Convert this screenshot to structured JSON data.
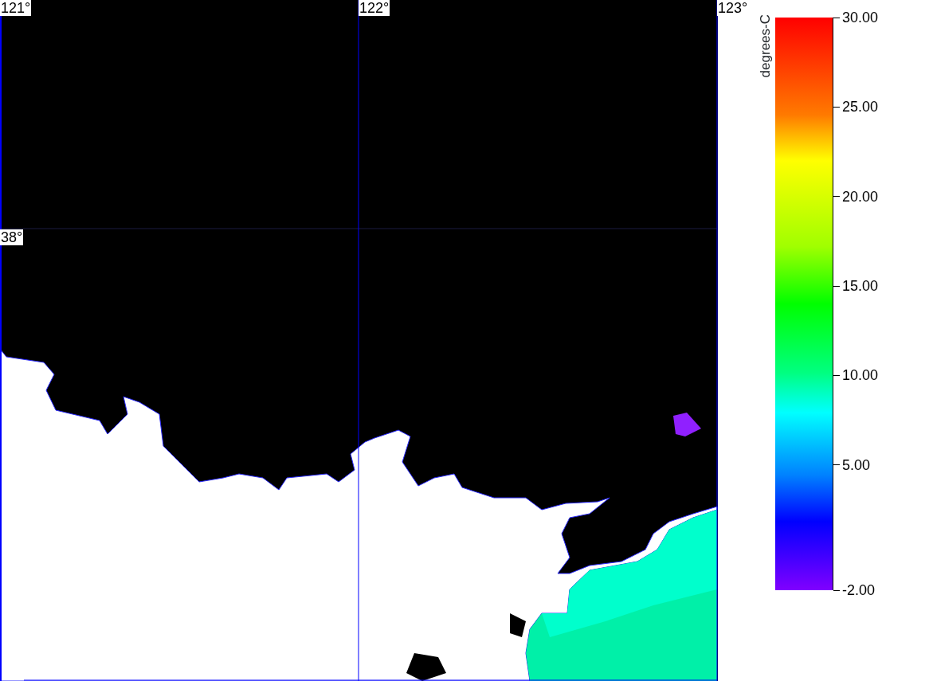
{
  "map": {
    "longitude_labels": [
      "121°",
      "122°",
      "123°"
    ],
    "latitude_labels": [
      "38°"
    ]
  },
  "colorbar": {
    "unit_label": "degrees-C",
    "ticks": [
      "30.00",
      "25.00",
      "20.00",
      "15.00",
      "10.00",
      "5.00",
      "-2.00"
    ]
  }
}
